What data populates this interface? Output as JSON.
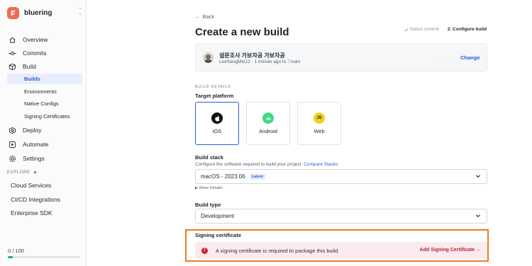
{
  "app": {
    "name": "bluering"
  },
  "nav": {
    "overview": "Overview",
    "commits": "Commits",
    "build": "Build",
    "build_children": [
      "Builds",
      "Environments",
      "Native Configs",
      "Signing Certificates"
    ],
    "deploy": "Deploy",
    "automate": "Automate",
    "settings": "Settings"
  },
  "explore": {
    "label": "EXPLORE",
    "items": [
      "Cloud Services",
      "CI/CD Integrations",
      "Enterprise SDK"
    ]
  },
  "usage": {
    "text": "0 / 100",
    "fraction": 0.07
  },
  "header": {
    "back": "Back",
    "title": "Create a new build",
    "step1": "Select commit",
    "step2": "2. Configure build"
  },
  "commit": {
    "message": "설문조사 가보자공 가보자공",
    "author": "LeeSangMin12",
    "time": "1 minute ago",
    "to": "to",
    "branch": "main",
    "hash": "· · · ·",
    "change": "Change"
  },
  "details": {
    "section": "BUILD DETAILS",
    "target_platform": "Target platform",
    "platforms": [
      "iOS",
      "Android",
      "Web"
    ],
    "selected_platform": "iOS",
    "build_stack_label": "Build stack",
    "build_stack_help": "Configure the software required to build your project.",
    "compare_stacks": "Compare Stacks",
    "build_stack_value": "macOS - 2023.06",
    "build_stack_badge": "Latest",
    "more_details": "More Details",
    "build_type_label": "Build type",
    "build_type_value": "Development"
  },
  "signing": {
    "label": "Signing certificate",
    "alert": "A signing certificate is required to package this build.",
    "link": "Add Signing Certificate →",
    "error_icon": "!"
  },
  "colors": {
    "accent": "#2d5bd7",
    "error": "#d1242f",
    "highlight": "#f07b1f",
    "brand": "#f46a4e"
  }
}
